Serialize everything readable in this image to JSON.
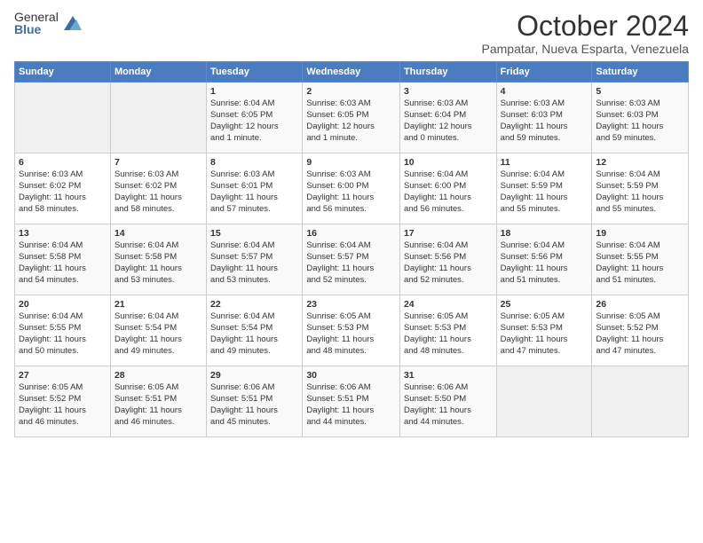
{
  "header": {
    "logo_general": "General",
    "logo_blue": "Blue",
    "month_year": "October 2024",
    "location": "Pampatar, Nueva Esparta, Venezuela"
  },
  "days_of_week": [
    "Sunday",
    "Monday",
    "Tuesday",
    "Wednesday",
    "Thursday",
    "Friday",
    "Saturday"
  ],
  "weeks": [
    [
      {
        "day": "",
        "info": ""
      },
      {
        "day": "",
        "info": ""
      },
      {
        "day": "1",
        "info": "Sunrise: 6:04 AM\nSunset: 6:05 PM\nDaylight: 12 hours\nand 1 minute."
      },
      {
        "day": "2",
        "info": "Sunrise: 6:03 AM\nSunset: 6:05 PM\nDaylight: 12 hours\nand 1 minute."
      },
      {
        "day": "3",
        "info": "Sunrise: 6:03 AM\nSunset: 6:04 PM\nDaylight: 12 hours\nand 0 minutes."
      },
      {
        "day": "4",
        "info": "Sunrise: 6:03 AM\nSunset: 6:03 PM\nDaylight: 11 hours\nand 59 minutes."
      },
      {
        "day": "5",
        "info": "Sunrise: 6:03 AM\nSunset: 6:03 PM\nDaylight: 11 hours\nand 59 minutes."
      }
    ],
    [
      {
        "day": "6",
        "info": "Sunrise: 6:03 AM\nSunset: 6:02 PM\nDaylight: 11 hours\nand 58 minutes."
      },
      {
        "day": "7",
        "info": "Sunrise: 6:03 AM\nSunset: 6:02 PM\nDaylight: 11 hours\nand 58 minutes."
      },
      {
        "day": "8",
        "info": "Sunrise: 6:03 AM\nSunset: 6:01 PM\nDaylight: 11 hours\nand 57 minutes."
      },
      {
        "day": "9",
        "info": "Sunrise: 6:03 AM\nSunset: 6:00 PM\nDaylight: 11 hours\nand 56 minutes."
      },
      {
        "day": "10",
        "info": "Sunrise: 6:04 AM\nSunset: 6:00 PM\nDaylight: 11 hours\nand 56 minutes."
      },
      {
        "day": "11",
        "info": "Sunrise: 6:04 AM\nSunset: 5:59 PM\nDaylight: 11 hours\nand 55 minutes."
      },
      {
        "day": "12",
        "info": "Sunrise: 6:04 AM\nSunset: 5:59 PM\nDaylight: 11 hours\nand 55 minutes."
      }
    ],
    [
      {
        "day": "13",
        "info": "Sunrise: 6:04 AM\nSunset: 5:58 PM\nDaylight: 11 hours\nand 54 minutes."
      },
      {
        "day": "14",
        "info": "Sunrise: 6:04 AM\nSunset: 5:58 PM\nDaylight: 11 hours\nand 53 minutes."
      },
      {
        "day": "15",
        "info": "Sunrise: 6:04 AM\nSunset: 5:57 PM\nDaylight: 11 hours\nand 53 minutes."
      },
      {
        "day": "16",
        "info": "Sunrise: 6:04 AM\nSunset: 5:57 PM\nDaylight: 11 hours\nand 52 minutes."
      },
      {
        "day": "17",
        "info": "Sunrise: 6:04 AM\nSunset: 5:56 PM\nDaylight: 11 hours\nand 52 minutes."
      },
      {
        "day": "18",
        "info": "Sunrise: 6:04 AM\nSunset: 5:56 PM\nDaylight: 11 hours\nand 51 minutes."
      },
      {
        "day": "19",
        "info": "Sunrise: 6:04 AM\nSunset: 5:55 PM\nDaylight: 11 hours\nand 51 minutes."
      }
    ],
    [
      {
        "day": "20",
        "info": "Sunrise: 6:04 AM\nSunset: 5:55 PM\nDaylight: 11 hours\nand 50 minutes."
      },
      {
        "day": "21",
        "info": "Sunrise: 6:04 AM\nSunset: 5:54 PM\nDaylight: 11 hours\nand 49 minutes."
      },
      {
        "day": "22",
        "info": "Sunrise: 6:04 AM\nSunset: 5:54 PM\nDaylight: 11 hours\nand 49 minutes."
      },
      {
        "day": "23",
        "info": "Sunrise: 6:05 AM\nSunset: 5:53 PM\nDaylight: 11 hours\nand 48 minutes."
      },
      {
        "day": "24",
        "info": "Sunrise: 6:05 AM\nSunset: 5:53 PM\nDaylight: 11 hours\nand 48 minutes."
      },
      {
        "day": "25",
        "info": "Sunrise: 6:05 AM\nSunset: 5:53 PM\nDaylight: 11 hours\nand 47 minutes."
      },
      {
        "day": "26",
        "info": "Sunrise: 6:05 AM\nSunset: 5:52 PM\nDaylight: 11 hours\nand 47 minutes."
      }
    ],
    [
      {
        "day": "27",
        "info": "Sunrise: 6:05 AM\nSunset: 5:52 PM\nDaylight: 11 hours\nand 46 minutes."
      },
      {
        "day": "28",
        "info": "Sunrise: 6:05 AM\nSunset: 5:51 PM\nDaylight: 11 hours\nand 46 minutes."
      },
      {
        "day": "29",
        "info": "Sunrise: 6:06 AM\nSunset: 5:51 PM\nDaylight: 11 hours\nand 45 minutes."
      },
      {
        "day": "30",
        "info": "Sunrise: 6:06 AM\nSunset: 5:51 PM\nDaylight: 11 hours\nand 44 minutes."
      },
      {
        "day": "31",
        "info": "Sunrise: 6:06 AM\nSunset: 5:50 PM\nDaylight: 11 hours\nand 44 minutes."
      },
      {
        "day": "",
        "info": ""
      },
      {
        "day": "",
        "info": ""
      }
    ]
  ]
}
